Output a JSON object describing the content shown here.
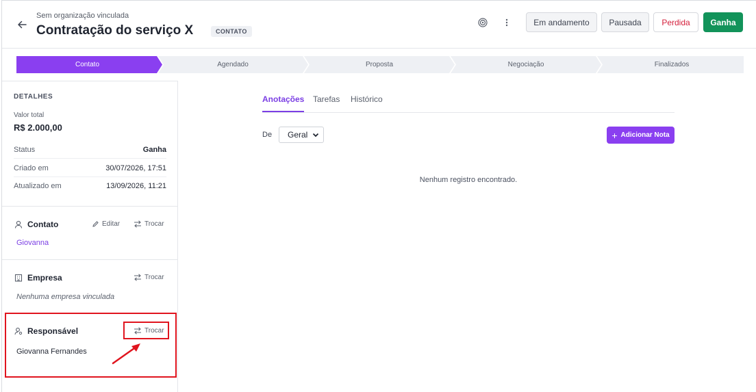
{
  "header": {
    "organization": "Sem organização vinculada",
    "title": "Contratação do serviço X",
    "stage_badge": "CONTATO",
    "buttons": {
      "in_progress": "Em andamento",
      "paused": "Pausada",
      "lost": "Perdida",
      "won": "Ganha"
    }
  },
  "pipeline": {
    "stages": [
      "Contato",
      "Agendado",
      "Proposta",
      "Negociação",
      "Finalizados"
    ],
    "active_index": 0
  },
  "details": {
    "title": "DETALHES",
    "total_label": "Valor total",
    "total_value": "R$ 2.000,00",
    "rows": [
      {
        "label": "Status",
        "value": "Ganha"
      },
      {
        "label": "Criado em",
        "value": "30/07/2026, 17:51"
      },
      {
        "label": "Atualizado em",
        "value": "13/09/2026, 11:21"
      }
    ]
  },
  "contact": {
    "title": "Contato",
    "edit_label": "Editar",
    "swap_label": "Trocar",
    "name": "Giovanna"
  },
  "company": {
    "title": "Empresa",
    "swap_label": "Trocar",
    "empty_text": "Nenhuma empresa vinculada"
  },
  "owner": {
    "title": "Responsável",
    "swap_label": "Trocar",
    "name": "Giovanna Fernandes"
  },
  "main": {
    "tabs": [
      "Anotações",
      "Tarefas",
      "Histórico"
    ],
    "active_tab": 0,
    "filter_label": "De",
    "filter_value": "Geral",
    "add_note_label": "Adicionar Nota",
    "empty_message": "Nenhum registro encontrado."
  },
  "colors": {
    "accent": "#8a3ff0",
    "won": "#12935a",
    "lost": "#d41f3b",
    "annotation": "#e0141e"
  }
}
